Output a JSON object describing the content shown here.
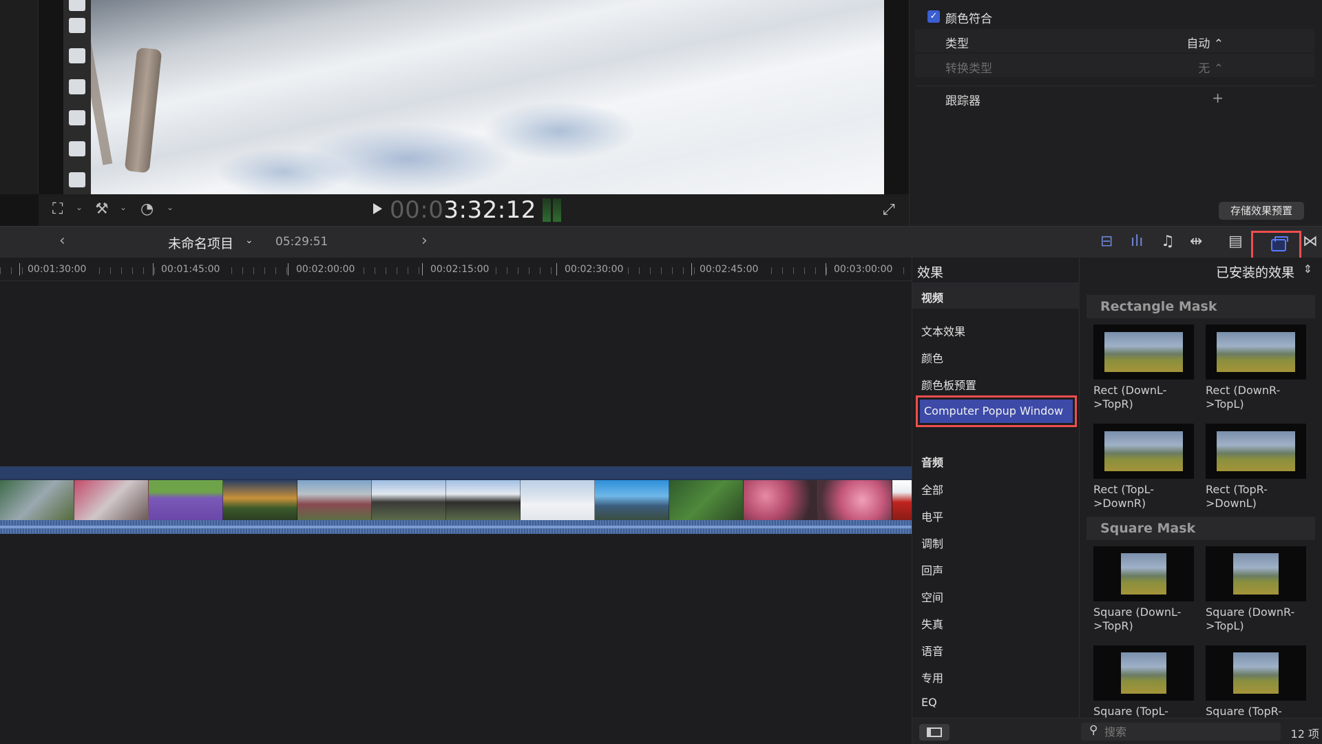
{
  "viewer": {
    "timecode_dim": "00:0",
    "timecode_main": "3:32:12"
  },
  "inspector": {
    "color_match_label": "颜色符合",
    "type_label": "类型",
    "type_value": "自动 ⌃",
    "conversion_label": "转换类型",
    "conversion_value": "无 ⌃",
    "tracker_label": "跟踪器",
    "tracker_add": "+",
    "save_preset": "存储效果预置"
  },
  "timeline": {
    "project_name": "未命名项目",
    "duration": "05:29:51",
    "ruler": [
      "00:01:30:00",
      "00:01:45:00",
      "00:02:00:00",
      "00:02:15:00",
      "00:02:30:00",
      "00:02:45:00",
      "00:03:00:00"
    ]
  },
  "effects": {
    "title": "效果",
    "installed": "已安装的效果",
    "video_header": "视频",
    "video_items": [
      "文本效果",
      "颜色",
      "颜色板预置"
    ],
    "selected_item": "Computer Popup Window",
    "audio_header": "音频",
    "audio_items": [
      "全部",
      "电平",
      "调制",
      "回声",
      "空间",
      "失真",
      "语音",
      "专用",
      "EQ"
    ],
    "groups": [
      {
        "title": "Rectangle Mask",
        "items": [
          "Rect (DownL->TopR)",
          "Rect (DownR->TopL)",
          "Rect (TopL->DownR)",
          "Rect (TopR->DownL)"
        ]
      },
      {
        "title": "Square Mask",
        "items": [
          "Square (DownL->TopR)",
          "Square (DownR->TopL)",
          "Square (TopL->DownR)",
          "Square (TopR->DownL)"
        ]
      }
    ],
    "search_placeholder": "搜索",
    "item_count": "12 项"
  },
  "colors": {
    "accent": "#3d4aa8",
    "highlight_outline": "#ee4e4e",
    "checkbox": "#3b5ed1"
  }
}
